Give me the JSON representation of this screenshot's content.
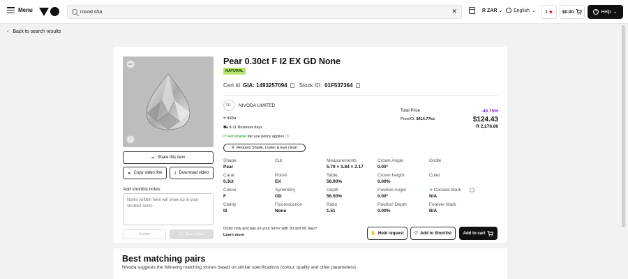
{
  "header": {
    "menu_label": "Menu",
    "search_value": "round sha",
    "currency": "R ZAR",
    "language": "English",
    "favourites_count": "1",
    "cart_total": "$0.00",
    "help_label": "Help"
  },
  "nav": {
    "back_label": "Back to search results"
  },
  "product": {
    "title": "Pear 0.30ct F I2 EX GD None",
    "badge": "NATURAL",
    "cert_prefix": "Cert Id",
    "cert_lab": "GIA: 1493257094",
    "stock_prefix": "Stock ID:",
    "stock_id": "01F537364",
    "image_badge_top": "360°",
    "image_badge_bottom": "☐"
  },
  "media_actions": {
    "share": "Share this item",
    "copy_video": "Copy video link",
    "download_video": "Download video"
  },
  "notes": {
    "label": "Add shortlist notes",
    "placeholder": "Notes written here will show up in your shortlist items",
    "delete": "Delete",
    "save": "Save notes"
  },
  "supplier": {
    "initials": "NL",
    "name": "NIVODA LIMITED",
    "location": "India",
    "shipping": "8-11 Business days",
    "returnable": "Returnable",
    "policy": "fair use policy applies",
    "request_button": "Request Shade, Luster & Eye clean"
  },
  "pricing": {
    "total_label": "Total Price",
    "discount": "-40.75%",
    "per_ct_label": "Price/Ct:",
    "per_ct_value": "$414.77/ct",
    "price_usd": "$124.43",
    "price_zar": "R 2,278.86"
  },
  "specs": [
    {
      "label": "Shape",
      "value": "Pear"
    },
    {
      "label": "Cut",
      "value": ""
    },
    {
      "label": "Measurements",
      "value": "5.79 × 3.84 × 2.17"
    },
    {
      "label": "Crown Angle",
      "value": "0.00°"
    },
    {
      "label": "Girdle",
      "value": ""
    },
    {
      "label": "Carat",
      "value": "0.3ct"
    },
    {
      "label": "Polish",
      "value": "EX"
    },
    {
      "label": "Table",
      "value": "56.00%"
    },
    {
      "label": "Crown height",
      "value": "0.00%"
    },
    {
      "label": "Culet",
      "value": ""
    },
    {
      "label": "Colour",
      "value": "F"
    },
    {
      "label": "Symmetry",
      "value": "GD"
    },
    {
      "label": "Depth",
      "value": "56.50%"
    },
    {
      "label": "Pavilion Angle",
      "value": "0.00°"
    },
    {
      "label": "Canada Mark",
      "value": "N/A"
    },
    {
      "label": "Clarity",
      "value": "I2"
    },
    {
      "label": "Fluorescence",
      "value": "None"
    },
    {
      "label": "Ratio",
      "value": "1.51"
    },
    {
      "label": "Pavilion Depth",
      "value": "0.00%"
    },
    {
      "label": "Forever Mark",
      "value": "N/A"
    }
  ],
  "footer_actions": {
    "order_note": "Order now and pay on your terms with 30 and 60 days*",
    "learn_more": "Learn more",
    "hold": "Hold request",
    "shortlist": "Add to Shortlist",
    "add_to_cart": "Add to cart"
  },
  "pairs": {
    "title": "Best matching pairs",
    "subtitle": "Nivoda suggests the following matching stones based on similar specifications (colour, quality and other parameters)"
  },
  "colors": {
    "badge_green": "#b6e66e",
    "discount_purple": "#7a1fd1",
    "favourite_red": "#e0001b"
  }
}
